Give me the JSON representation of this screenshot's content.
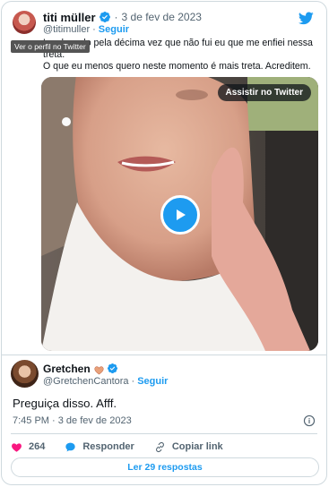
{
  "quoted_tweet": {
    "author_name": "titi müller",
    "handle": "@titimuller",
    "follow_label": "Seguir",
    "date": "3 de fev de 2023",
    "tooltip": "Ver o perfil no Twitter",
    "text_line_1": "Lembrando pela décima vez que não fui eu que me enfiei nessa",
    "text_line_2": "treta.",
    "text_line_3": "O que eu menos quero neste momento é mais treta. Acreditem.",
    "video": {
      "watch_label": "Assistir no Twitter"
    }
  },
  "main_tweet": {
    "author_name": "Gretchen",
    "handle": "@GretchenCantora",
    "follow_label": "Seguir",
    "text": "Preguiça disso. Afff.",
    "timestamp": "7:45 PM · 3 de fev de 2023",
    "likes": "264",
    "reply_label": "Responder",
    "copy_link_label": "Copiar link",
    "read_replies_label": "Ler 29 respostas"
  },
  "colors": {
    "accent": "#1d9bf0",
    "heart": "#f91880",
    "muted_text": "#536471",
    "border": "#cfd9de"
  },
  "icons": [
    "twitter-bird-icon",
    "verified-badge-icon",
    "heart-emoji-icon",
    "play-icon",
    "info-icon",
    "like-heart-icon",
    "reply-bubble-icon",
    "link-icon"
  ]
}
